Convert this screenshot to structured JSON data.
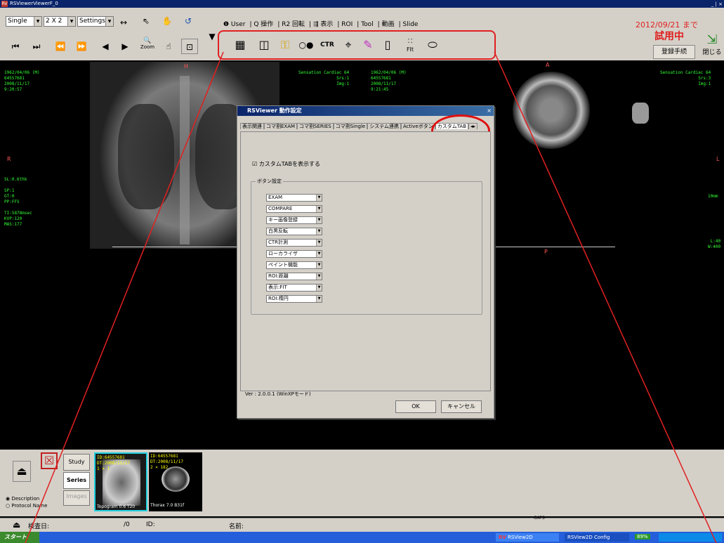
{
  "window": {
    "title": "RSViewerViewerF_0",
    "controls": "_ | ×"
  },
  "toolbar": {
    "layout_select": "Single",
    "grid_select": "2 X 2",
    "settings_select": "Settings",
    "tabs": [
      "❶ User",
      "Q 操作",
      "R2 回転",
      "⇶ 表示",
      "ROI",
      "Tool",
      "動画",
      "Slide"
    ],
    "zoom_label": "Zoom",
    "custom_buttons": [
      "grid",
      "compare",
      "key",
      "invert",
      "CTR",
      "localizer",
      "paint",
      "distance",
      "FIT",
      "ellipse"
    ],
    "fit_label": "FIt",
    "ctr_label": "CTR"
  },
  "trial": {
    "date": "2012/09/21 まで",
    "status": "試用中",
    "register_button": "登録手続",
    "close_button": "閉じる"
  },
  "viewport_left": {
    "top_left": "1962/04/06 (M)\n64557681\n2008/11/17\n9:20:57",
    "top_right": "Sensation Cardiac 64\nSrs:1\nImg:1",
    "mid_left": "SL:0.6thk\n\nSP:1\nGT:0\nPP:FFS\n\nTI:5878msec\nKVP:120\nMAS:177",
    "orient_r": "R",
    "orient_top": "H"
  },
  "viewport_right": {
    "top_left": "1962/04/06 (M)\n64557681\n2008/11/17\n9:21:45",
    "top_right": "Sensation Cardiac 64\nSrs:3\nImg:1",
    "orient_a": "A",
    "orient_l": "L",
    "orient_p": "P",
    "scale": "10mm",
    "wl": "L:40\nW:400"
  },
  "dialog": {
    "title": "RSViewer 動作設定",
    "tabs": [
      "表示関連",
      "コマ割EXAM",
      "コマ割SERIES",
      "コマ割Single",
      "システム連携",
      "Activeボタン",
      "カスタムTAB"
    ],
    "checkbox_label": "カスタムTABを表示する",
    "checkbox_checked": true,
    "group_label": "ボタン設定",
    "button_settings": [
      "EXAM",
      "COMPARE",
      "キー画像登録",
      "白黒反転",
      "CTR計測",
      "ローカライザ",
      "ペイント機能",
      "ROI:距離",
      "表示:FIT",
      "ROI:楕円"
    ],
    "version": "Ver : 2.0.0.1  (WinXPモード)",
    "ok": "OK",
    "cancel": "キャンセル"
  },
  "bottom": {
    "study": "Study",
    "series": "Series",
    "images": "Images",
    "radio_description": "Description",
    "radio_protocol": "Protocol Name",
    "thumb1_info": "ID:64557681\nDT:2008/11/17\n1 × 1",
    "thumb1_label": "Topogram 0.6  T20",
    "thumb2_info": "ID:64557681\nDT:2008/11/17\n2 × 182",
    "thumb2_label": "Thorax 7.0  B31f"
  },
  "status": {
    "exam_date_label": "検査日:",
    "page": "/0",
    "id_label": "ID:",
    "name_label": "名前:",
    "caps": "CAPS"
  },
  "taskbar": {
    "start": "スタート",
    "task1": "RSView2D",
    "task2": "RSView2D Config",
    "battery": "89%"
  }
}
